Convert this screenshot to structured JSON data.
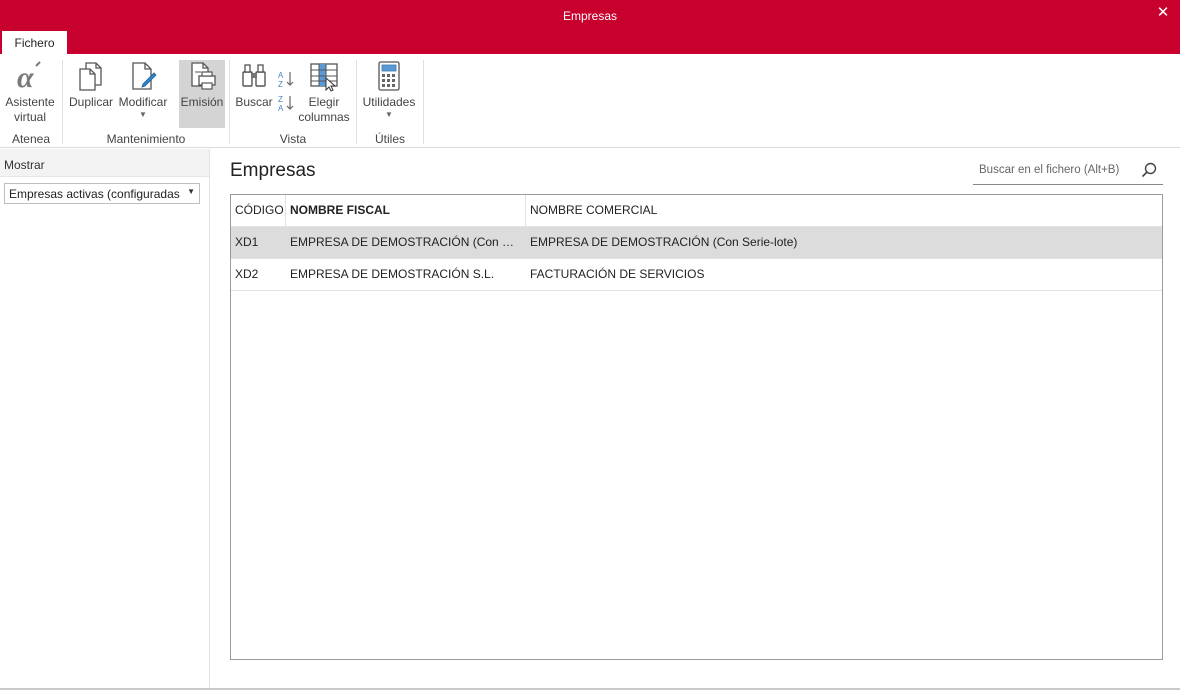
{
  "window": {
    "title": "Empresas",
    "close_glyph": "✕"
  },
  "tabs": [
    {
      "label": "Fichero"
    }
  ],
  "ribbon": {
    "buttons": {
      "asistente": {
        "line1": "Asistente",
        "line2": "virtual",
        "icon": "alpha-icon"
      },
      "duplicar": {
        "label": "Duplicar",
        "icon": "duplicate-icon"
      },
      "modificar": {
        "label": "Modificar",
        "icon": "edit-document-icon"
      },
      "emision": {
        "label": "Emisión",
        "icon": "printer-icon"
      },
      "buscar": {
        "label": "Buscar",
        "icon": "binoculars-icon"
      },
      "elegir": {
        "line1": "Elegir",
        "line2": "columnas",
        "icon": "columns-icon"
      },
      "utilidades": {
        "label": "Utilidades",
        "icon": "calculator-icon"
      }
    },
    "groups": {
      "atenea": "Atenea",
      "mantenimiento": "Mantenimiento",
      "vista": "Vista",
      "utiles": "Útiles"
    }
  },
  "sidebar": {
    "header": "Mostrar",
    "filter_value": "Empresas activas (configuradas para"
  },
  "main": {
    "title": "Empresas",
    "search_placeholder": "Buscar en el fichero (Alt+B)",
    "columns": [
      "CÓDIGO",
      "NOMBRE FISCAL",
      "NOMBRE COMERCIAL"
    ],
    "rows": [
      {
        "codigo": "XD1",
        "nombre_fiscal": "EMPRESA DE DEMOSTRACIÓN (Con Serie-lote)",
        "nombre_comercial": "EMPRESA DE DEMOSTRACIÓN (Con Serie-lote)",
        "selected": true
      },
      {
        "codigo": "XD2",
        "nombre_fiscal": "EMPRESA DE DEMOSTRACIÓN S.L.",
        "nombre_comercial": "FACTURACIÓN DE SERVICIOS",
        "selected": false
      }
    ]
  },
  "colors": {
    "brand": "#c8002e",
    "selected_row": "#dcdcdc",
    "active_button": "#d4d4d4"
  }
}
